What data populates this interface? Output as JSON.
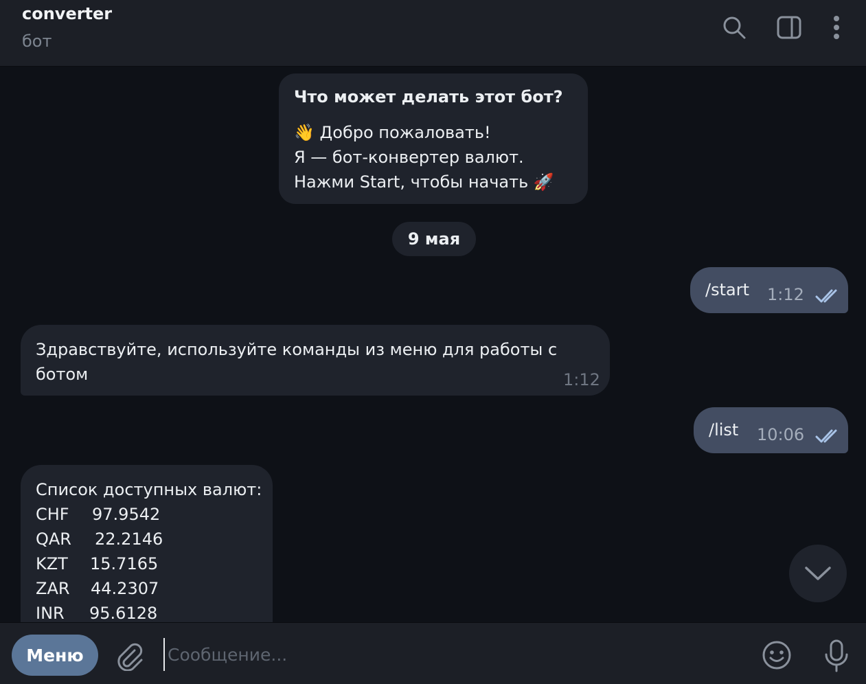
{
  "header": {
    "title": "converter",
    "subtitle": "бот",
    "icons": [
      "search-icon",
      "sidebar-toggle-icon",
      "more-vertical-icon"
    ]
  },
  "intro": {
    "heading": "Что может делать этот бот?",
    "line1": "👋 Добро пожаловать!",
    "line2": "Я — бот-конвертер валют.",
    "line3": "Нажми Start, чтобы начать 🚀"
  },
  "date_separator": "9 мая",
  "messages": [
    {
      "dir": "out",
      "text": "/start",
      "time": "1:12",
      "status": "read"
    },
    {
      "dir": "in",
      "text_line1": "Здравствуйте, используйте команды из меню для работы с",
      "text_line2": "ботом",
      "time": "1:12"
    },
    {
      "dir": "out",
      "text": "/list",
      "time": "10:06",
      "status": "read"
    },
    {
      "dir": "in",
      "heading": "Список доступных валют:",
      "currencies": [
        {
          "code": "CHF",
          "rate": "97.9542"
        },
        {
          "code": "QAR",
          "rate": "22.2146"
        },
        {
          "code": "KZT",
          "rate": "15.7165"
        },
        {
          "code": "ZAR",
          "rate": "44.2307"
        },
        {
          "code": "INR",
          "rate": "95.6128"
        }
      ]
    }
  ],
  "composer": {
    "menu_label": "Меню",
    "placeholder": "Сообщение..."
  },
  "colors": {
    "background": "#0e1117",
    "header": "#1c1f26",
    "incoming_bubble": "#1f232c",
    "outgoing_bubble": "#434d62",
    "menu_button": "#5b7698",
    "read_check": "#a9c4e8"
  }
}
